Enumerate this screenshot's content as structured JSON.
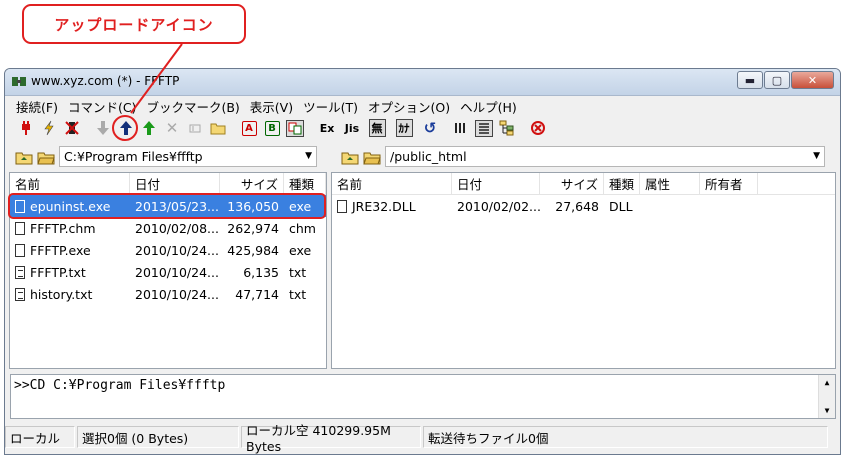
{
  "callout": {
    "text": "アップロードアイコン"
  },
  "window": {
    "title": "www.xyz.com (*) - FFFTP"
  },
  "menu": [
    "接続(F)",
    "コマンド(C)",
    "ブックマーク(B)",
    "表示(V)",
    "ツール(T)",
    "オプション(O)",
    "ヘルプ(H)"
  ],
  "toolbar": {
    "ascii_label": "A",
    "binary_label": "B",
    "exe_label": "Ex",
    "jis_label": "Jis",
    "nokanji_label": "無",
    "kana_label": "ｶﾅ"
  },
  "local": {
    "path": "C:¥Program Files¥ffftp",
    "columns": [
      "名前",
      "日付",
      "サイズ",
      "種類"
    ],
    "files": [
      {
        "name": "epuninst.exe",
        "date": "2013/05/23...",
        "size": "136,050",
        "type": "exe",
        "icon": "document-icon"
      },
      {
        "name": "FFFTP.chm",
        "date": "2010/02/08...",
        "size": "262,974",
        "type": "chm",
        "icon": "document-icon"
      },
      {
        "name": "FFFTP.exe",
        "date": "2010/10/24...",
        "size": "425,984",
        "type": "exe",
        "icon": "document-icon"
      },
      {
        "name": "FFFTP.txt",
        "date": "2010/10/24...",
        "size": "6,135",
        "type": "txt",
        "icon": "text-file-icon"
      },
      {
        "name": "history.txt",
        "date": "2010/10/24...",
        "size": "47,714",
        "type": "txt",
        "icon": "text-file-icon"
      }
    ]
  },
  "remote": {
    "path": "/public_html",
    "columns": [
      "名前",
      "日付",
      "サイズ",
      "種類",
      "属性",
      "所有者"
    ],
    "files": [
      {
        "name": "JRE32.DLL",
        "date": "2010/02/02...",
        "size": "27,648",
        "type": "DLL",
        "icon": "document-icon"
      }
    ]
  },
  "log": {
    "text": ">>CD C:¥Program Files¥ffftp"
  },
  "status": {
    "local": "ローカル",
    "selected": "選択0個 (0 Bytes)",
    "free": "ローカル空 410299.95M Bytes",
    "queue": "転送待ちファイル0個"
  },
  "colors": {
    "accent_red": "#e02020",
    "selection_blue": "#3a80e0"
  }
}
